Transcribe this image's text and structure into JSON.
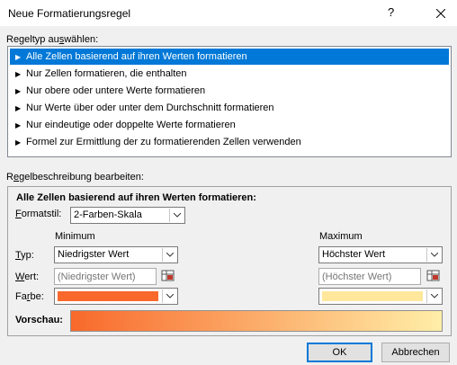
{
  "window": {
    "title": "Neue Formatierungsregel",
    "help_label": "?",
    "close_icon": "close-icon"
  },
  "ruletype": {
    "label_prefix": "Regeltyp au",
    "label_accel": "s",
    "label_suffix": "wählen:",
    "items": [
      {
        "label": "Alle Zellen basierend auf ihren Werten formatieren",
        "selected": true
      },
      {
        "label": "Nur Zellen formatieren, die enthalten",
        "selected": false
      },
      {
        "label": "Nur obere oder untere Werte formatieren",
        "selected": false
      },
      {
        "label": "Nur Werte über oder unter dem Durchschnitt formatieren",
        "selected": false
      },
      {
        "label": "Nur eindeutige oder doppelte Werte formatieren",
        "selected": false
      },
      {
        "label": "Formel zur Ermittlung der zu formatierenden Zellen verwenden",
        "selected": false
      }
    ]
  },
  "description": {
    "label_prefix": "R",
    "label_accel": "e",
    "label_suffix": "gelbeschreibung bearbeiten:",
    "title": "Alle Zellen basierend auf ihren Werten formatieren:",
    "format_style": {
      "label_accel": "F",
      "label_suffix": "ormatstil:",
      "value": "2-Farben-Skala"
    },
    "minimum_header": "Minimum",
    "maximum_header": "Maximum",
    "type": {
      "label_accel": "T",
      "label_suffix": "yp:",
      "min_value": "Niedrigster Wert",
      "max_value": "Höchster Wert"
    },
    "value": {
      "label_accel": "W",
      "label_suffix": "ert:",
      "min_placeholder": "(Niedrigster Wert)",
      "max_placeholder": "(Höchster Wert)"
    },
    "color": {
      "label_prefix": "Fa",
      "label_accel": "r",
      "label_suffix": "be:",
      "min_color": "#f8692b",
      "max_color": "#ffe79c"
    },
    "preview": {
      "label": "Vorschau:",
      "gradient_start": "#f8692b",
      "gradient_end": "#ffefa8"
    }
  },
  "buttons": {
    "ok": "OK",
    "cancel": "Abbrechen"
  },
  "colors": {
    "selection": "#0078d7"
  }
}
